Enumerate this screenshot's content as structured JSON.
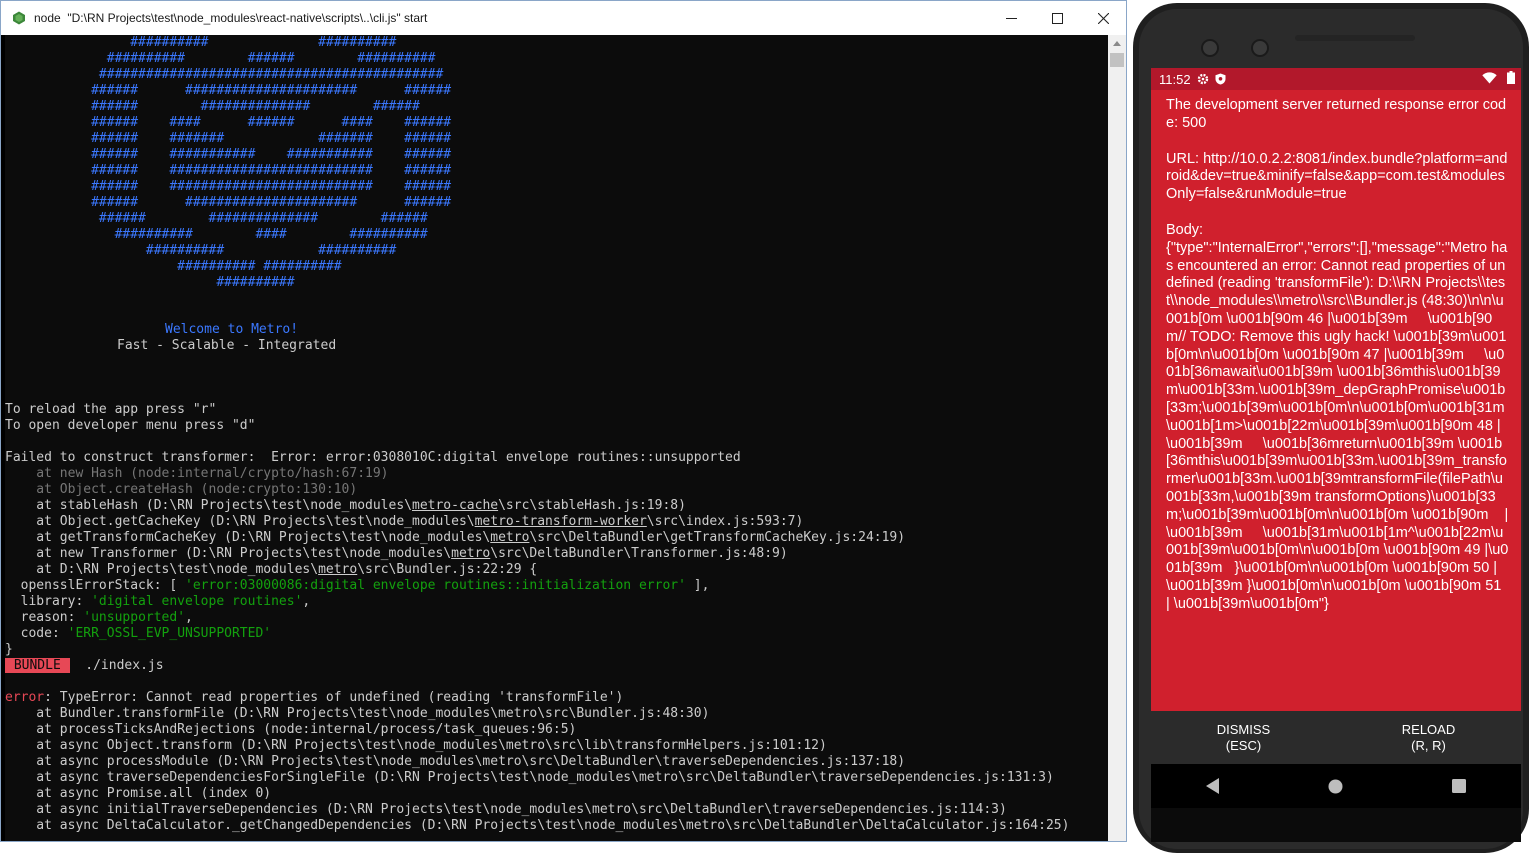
{
  "window": {
    "title": "node  \"D:\\RN Projects\\test\\node_modules\\react-native\\scripts\\..\\cli.js\" start",
    "icon": "nodejs-hexagon-icon"
  },
  "console": {
    "logo_lines": [
      "                ##########              ##########",
      "             ##########        ######        ##########",
      "            ############################################",
      "           ######      ######################      ######",
      "           ######        ##############        ######",
      "           ######    ####      ######      ####    ######",
      "           ######    #######            #######    ######",
      "           ######    ###########    ###########    ######",
      "           ######    ##########################    ######",
      "           ######    ##########################    ######",
      "           ######      ######################      ######",
      "            ######        ##############        ######",
      "              ##########        ####        ##########",
      "                  ##########            ##########",
      "                      ########## ##########",
      "                           ##########"
    ],
    "welcome": "Welcome to Metro!",
    "tagline": "Fast - Scalable - Integrated",
    "reload_hint": "To reload the app press \"r\"",
    "devmenu_hint": "To open developer menu press \"d\"",
    "transformer_error": "Failed to construct transformer:  Error: error:0308010C:digital envelope routines::unsupported",
    "stack1_dim": [
      "    at new Hash (node:internal/crypto/hash:67:19)",
      "    at Object.createHash (node:crypto:130:10)"
    ],
    "stack1": [
      {
        "pre": "    at stableHash (D:\\RN Projects\\test\\node_modules\\",
        "link": "metro-cache",
        "post": "\\src\\stableHash.js:19:8)"
      },
      {
        "pre": "    at Object.getCacheKey (D:\\RN Projects\\test\\node_modules\\",
        "link": "metro-transform-worker",
        "post": "\\src\\index.js:593:7)"
      },
      {
        "pre": "    at getTransformCacheKey (D:\\RN Projects\\test\\node_modules\\",
        "link": "metro",
        "post": "\\src\\DeltaBundler\\getTransformCacheKey.js:24:19)"
      },
      {
        "pre": "    at new Transformer (D:\\RN Projects\\test\\node_modules\\",
        "link": "metro",
        "post": "\\src\\DeltaBundler\\Transformer.js:48:9)"
      },
      {
        "pre": "    at D:\\RN Projects\\test\\node_modules\\",
        "link": "metro",
        "post": "\\src\\Bundler.js:22:29 {"
      }
    ],
    "props": [
      {
        "key": "  opensslErrorStack: [ ",
        "val": "'error:03000086:digital envelope routines::initialization error'",
        "tail": " ],"
      },
      {
        "key": "  library: ",
        "val": "'digital envelope routines'",
        "tail": ","
      },
      {
        "key": "  reason: ",
        "val": "'unsupported'",
        "tail": ","
      },
      {
        "key": "  code: ",
        "val": "'ERR_OSSL_EVP_UNSUPPORTED'",
        "tail": ""
      }
    ],
    "close_brace": "}",
    "bundle_badge": " BUNDLE ",
    "bundle_file": "  ./index.js",
    "error_label": "error",
    "error_msg": ": TypeError: Cannot read properties of undefined (reading 'transformFile')",
    "stack2": [
      "    at Bundler.transformFile (D:\\RN Projects\\test\\node_modules\\metro\\src\\Bundler.js:48:30)",
      "    at processTicksAndRejections (node:internal/process/task_queues:96:5)",
      "    at async Object.transform (D:\\RN Projects\\test\\node_modules\\metro\\src\\lib\\transformHelpers.js:101:12)",
      "    at async processModule (D:\\RN Projects\\test\\node_modules\\metro\\src\\DeltaBundler\\traverseDependencies.js:137:18)",
      "    at async traverseDependenciesForSingleFile (D:\\RN Projects\\test\\node_modules\\metro\\src\\DeltaBundler\\traverseDependencies.js:131:3)",
      "    at async Promise.all (index 0)",
      "    at async initialTraverseDependencies (D:\\RN Projects\\test\\node_modules\\metro\\src\\DeltaBundler\\traverseDependencies.js:114:3)",
      "    at async DeltaCalculator._getChangedDependencies (D:\\RN Projects\\test\\node_modules\\metro\\src\\DeltaBundler\\DeltaCalculator.js:164:25)"
    ]
  },
  "phone": {
    "status_time": "11:52",
    "error_title": "The development server returned response error code: 500",
    "url_text": "URL: http://10.0.2.2:8081/index.bundle?platform=android&dev=true&minify=false&app=com.test&modulesOnly=false&runModule=true",
    "body_text": "Body:\n{\"type\":\"InternalError\",\"errors\":[],\"message\":\"Metro has encountered an error: Cannot read properties of undefined (reading 'transformFile'): D:\\\\RN Projects\\\\test\\\\node_modules\\\\metro\\\\src\\\\Bundler.js (48:30)\\n\\n\\u001b[0m \\u001b[90m 46 |\\u001b[39m     \\u001b[90m// TODO: Remove this ugly hack! \\u001b[39m\\u001b[0m\\n\\u001b[0m \\u001b[90m 47 |\\u001b[39m     \\u001b[36mawait\\u001b[39m \\u001b[36mthis\\u001b[39m\\u001b[33m.\\u001b[39m_depGraphPromise\\u001b[33m;\\u001b[39m\\u001b[0m\\n\\u001b[0m\\u001b[31m\\u001b[1m>\\u001b[22m\\u001b[39m\\u001b[90m 48 |\\u001b[39m     \\u001b[36mreturn\\u001b[39m \\u001b[36mthis\\u001b[39m\\u001b[33m.\\u001b[39m_transformer\\u001b[33m.\\u001b[39mtransformFile(filePath\\u001b[33m,\\u001b[39m transformOptions)\\u001b[33m;\\u001b[39m\\u001b[0m\\n\\u001b[0m \\u001b[90m    |\\u001b[39m     \\u001b[31m\\u001b[1m^\\u001b[22m\\u001b[39m\\u001b[0m\\n\\u001b[0m \\u001b[90m 49 |\\u001b[39m   }\\u001b[0m\\n\\u001b[0m \\u001b[90m 50 |\\u001b[39m }\\u001b[0m\\n\\u001b[0m \\u001b[90m 51 | \\u001b[39m\\u001b[0m\"}",
    "dismiss_label": "DISMISS",
    "dismiss_key": "(ESC)",
    "reload_label": "RELOAD",
    "reload_key": "(R, R)"
  }
}
